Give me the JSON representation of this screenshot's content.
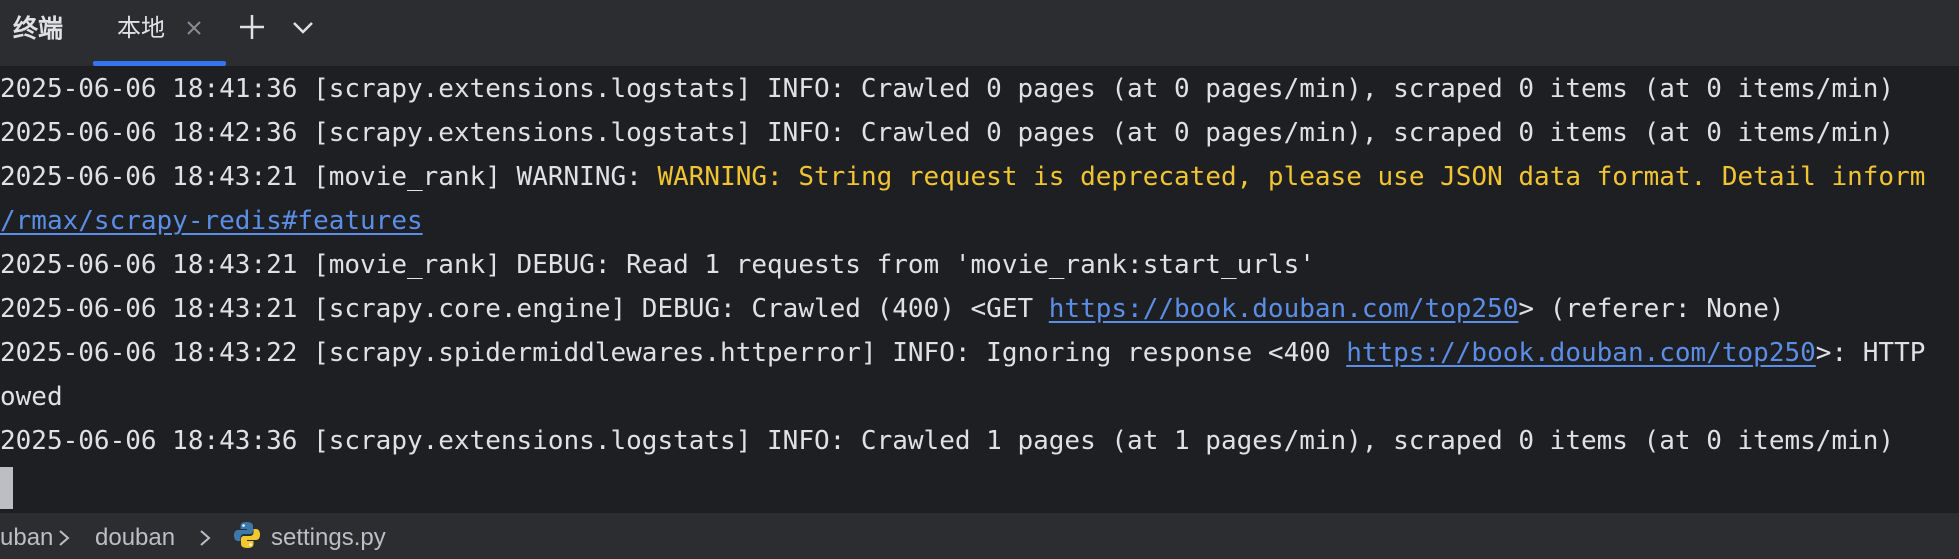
{
  "tabbar": {
    "tool_title": "终端",
    "tabs": [
      {
        "label": "本地",
        "active": true
      }
    ]
  },
  "terminal": {
    "lines": [
      {
        "segments": [
          {
            "text": "2025-06-06 18:41:36 [scrapy.extensions.logstats] INFO: Crawled 0 pages (at 0 pages/min), scraped 0 items (at 0 items/min)",
            "style": "normal"
          }
        ]
      },
      {
        "segments": [
          {
            "text": "2025-06-06 18:42:36 [scrapy.extensions.logstats] INFO: Crawled 0 pages (at 0 pages/min), scraped 0 items (at 0 items/min)",
            "style": "normal"
          }
        ]
      },
      {
        "segments": [
          {
            "text": "2025-06-06 18:43:21 [movie_rank] WARNING: ",
            "style": "normal"
          },
          {
            "text": "WARNING: String request is deprecated, please use JSON data format. Detail inform",
            "style": "warn"
          }
        ]
      },
      {
        "segments": [
          {
            "text": "/rmax/scrapy-redis#features",
            "style": "link"
          }
        ]
      },
      {
        "segments": [
          {
            "text": "2025-06-06 18:43:21 [movie_rank] DEBUG: Read 1 requests from 'movie_rank:start_urls'",
            "style": "normal"
          }
        ]
      },
      {
        "segments": [
          {
            "text": "2025-06-06 18:43:21 [scrapy.core.engine] DEBUG: Crawled (400) <GET ",
            "style": "normal"
          },
          {
            "text": "https://book.douban.com/top250",
            "style": "link"
          },
          {
            "text": "> (referer: None)",
            "style": "normal"
          }
        ]
      },
      {
        "segments": [
          {
            "text": "2025-06-06 18:43:22 [scrapy.spidermiddlewares.httperror] INFO: Ignoring response <400 ",
            "style": "normal"
          },
          {
            "text": "https://book.douban.com/top250",
            "style": "link"
          },
          {
            "text": ">: HTTP",
            "style": "normal"
          }
        ]
      },
      {
        "segments": [
          {
            "text": "owed",
            "style": "normal"
          }
        ]
      },
      {
        "segments": [
          {
            "text": "2025-06-06 18:43:36 [scrapy.extensions.logstats] INFO: Crawled 1 pages (at 1 pages/min), scraped 0 items (at 0 items/min)",
            "style": "normal"
          }
        ]
      }
    ]
  },
  "breadcrumb": {
    "items": [
      {
        "label": "uban",
        "icon": ""
      },
      {
        "label": "douban",
        "icon": ""
      },
      {
        "label": "settings.py",
        "icon": "python-file-icon"
      }
    ]
  },
  "colors": {
    "background": "#1e1f22",
    "panel": "#2b2d30",
    "text": "#dfe1e5",
    "warning": "#f0c433",
    "link": "#5b8ee6",
    "accent": "#3574f0"
  }
}
